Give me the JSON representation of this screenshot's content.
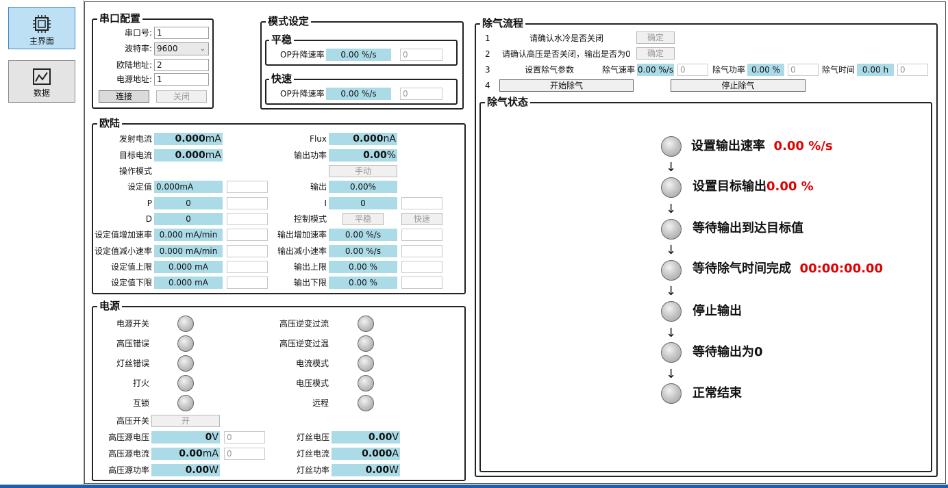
{
  "nav": {
    "main_label": "主界面",
    "data_label": "数据"
  },
  "serial": {
    "title": "串口配置",
    "port_label": "串口号:",
    "port_value": "1",
    "baud_label": "波特率:",
    "baud_value": "9600",
    "oulu_addr_label": "欧陆地址:",
    "oulu_addr_value": "2",
    "psu_addr_label": "电源地址:",
    "psu_addr_value": "1",
    "connect_label": "连接",
    "close_label": "关闭"
  },
  "mode": {
    "title": "模式设定",
    "steady_title": "平稳",
    "steady_label": "OP升降速率",
    "steady_value": "0.00 %/s",
    "steady_input": "0",
    "fast_title": "快速",
    "fast_label": "OP升降速率",
    "fast_value": "0.00 %/s",
    "fast_input": "0"
  },
  "oulu": {
    "title": "欧陆",
    "emit_label": "发射电流",
    "emit_num": "0.000",
    "emit_unit": "mA",
    "target_label": "目标电流",
    "target_num": "0.000",
    "target_unit": "mA",
    "op_mode_label": "操作模式",
    "setval_label": "设定值",
    "setval_value": "0.000mA",
    "p_label": "P",
    "p_value": "0",
    "d_label": "D",
    "d_value": "0",
    "inc_label": "设定值增加速率",
    "inc_value": "0.000 mA/min",
    "dec_label": "设定值减小速率",
    "dec_value": "0.000 mA/min",
    "upper_label": "设定值上限",
    "upper_value": "0.000 mA",
    "lower_label": "设定值下限",
    "lower_value": "0.000 mA",
    "flux_label": "Flux",
    "flux_num": "0.000",
    "flux_unit": "nA",
    "outpow_label": "输出功率",
    "outpow_num": "0.00",
    "outpow_unit": "%",
    "manual_btn": "手动",
    "output_label": "输出",
    "output_value": "0.00%",
    "i_label": "I",
    "i_value": "0",
    "ctrl_label": "控制模式",
    "ctrl_steady": "平稳",
    "ctrl_fast": "快速",
    "out_inc_label": "输出增加速率",
    "out_inc_value": "0.00 %/s",
    "out_dec_label": "输出减小速率",
    "out_dec_value": "0.00 %/s",
    "out_upper_label": "输出上限",
    "out_upper_value": "0.00 %",
    "out_lower_label": "输出下限",
    "out_lower_value": "0.00 %"
  },
  "psu": {
    "title": "电源",
    "leds_left": [
      "电源开关",
      "高压错误",
      "灯丝错误",
      "打火",
      "互锁"
    ],
    "leds_right": [
      "高压逆变过流",
      "高压逆变过温",
      "电流模式",
      "电压模式",
      "远程"
    ],
    "hv_switch_label": "高压开关",
    "hv_switch_btn": "开",
    "hv_volt_label": "高压源电压",
    "hv_volt_num": "0",
    "hv_volt_unit": "V",
    "hv_volt_input": "0",
    "hv_curr_label": "高压源电流",
    "hv_curr_num": "0.00",
    "hv_curr_unit": "mA",
    "hv_curr_input": "0",
    "hv_pow_label": "高压源功率",
    "hv_pow_num": "0.00",
    "hv_pow_unit": "W",
    "fil_volt_label": "灯丝电压",
    "fil_volt_num": "0.00",
    "fil_volt_unit": "V",
    "fil_curr_label": "灯丝电流",
    "fil_curr_num": "0.000",
    "fil_curr_unit": "A",
    "fil_pow_label": "灯丝功率",
    "fil_pow_num": "0.00",
    "fil_pow_unit": "W"
  },
  "degas": {
    "title": "除气流程",
    "n1": "1",
    "s1": "请确认水冷是否关闭",
    "b1": "确定",
    "n2": "2",
    "s2": "请确认高压是否关闭，输出是否为0",
    "b2": "确定",
    "n3": "3",
    "s3": "设置除气参数",
    "rate_label": "除气速率",
    "rate_value": "0.00 %/s",
    "rate_input": "0",
    "power_label": "除气功率",
    "power_value": "0.00 %",
    "power_input": "0",
    "time_label": "除气时间",
    "time_value": "0.00 h",
    "time_input": "0",
    "n4": "4",
    "start_btn": "开始除气",
    "stop_btn": "停止除气",
    "status_title": "除气状态",
    "steps": [
      {
        "label": "设置输出速率",
        "value": "0.00 %/s"
      },
      {
        "label": "设置目标输出",
        "value": "0.00 %"
      },
      {
        "label": "等待输出到达目标值",
        "value": ""
      },
      {
        "label": "等待除气时间完成",
        "value": "00:00:00.00"
      },
      {
        "label": "停止输出",
        "value": ""
      },
      {
        "label": "等待输出为0",
        "value": ""
      },
      {
        "label": "正常结束",
        "value": ""
      }
    ],
    "arrow": "↓"
  },
  "colors": {
    "value_bg": "#acdbe8",
    "active_nav": "#bde0f5",
    "status_value": "#e00000"
  }
}
